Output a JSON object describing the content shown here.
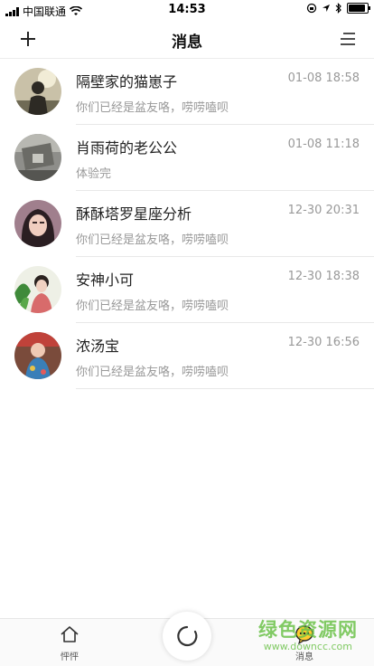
{
  "status_bar": {
    "carrier": "中国联通",
    "time": "14:53"
  },
  "nav": {
    "title": "消息"
  },
  "messages": [
    {
      "name": "隔壁家的猫崽子",
      "time": "01-08 18:58",
      "preview": "你们已经是盆友咯，唠唠嗑呗"
    },
    {
      "name": "肖雨荷的老公公",
      "time": "01-08 11:18",
      "preview": "体验完"
    },
    {
      "name": "酥酥塔罗星座分析",
      "time": "12-30 20:31",
      "preview": "你们已经是盆友咯，唠唠嗑呗"
    },
    {
      "name": "安神小可",
      "time": "12-30 18:38",
      "preview": "你们已经是盆友咯，唠唠嗑呗"
    },
    {
      "name": "浓汤宝",
      "time": "12-30 16:56",
      "preview": "你们已经是盆友咯，唠唠嗑呗"
    }
  ],
  "tabs": {
    "home_label": "怦怦",
    "messages_label": "消息"
  },
  "watermark": {
    "text": "绿色资源网",
    "url": "www.downcc.com"
  },
  "colors": {
    "accent": "#6cc24a",
    "muted_text": "#999999",
    "divider": "#e8e8e8"
  }
}
